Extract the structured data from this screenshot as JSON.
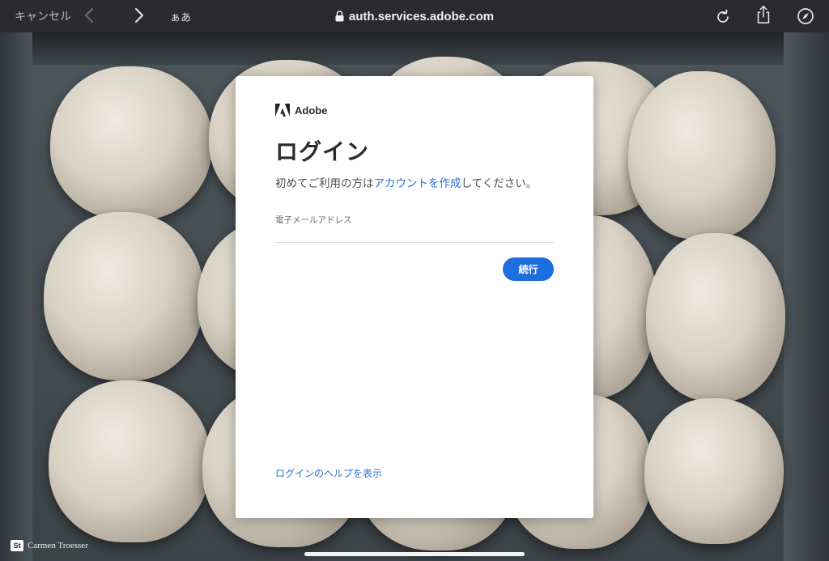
{
  "browser": {
    "cancel_label": "キャンセル",
    "text_size_label": "ぁあ",
    "url": "auth.services.adobe.com",
    "icons": {
      "back": "chevron-left-icon",
      "forward": "chevron-right-icon",
      "lock": "lock-icon",
      "reload": "reload-icon",
      "share": "share-icon",
      "compass": "compass-icon"
    }
  },
  "login": {
    "brand_name": "Adobe",
    "title": "ログイン",
    "subtitle_prefix": "初めてご利用の方は",
    "subtitle_link": "アカウントを作成",
    "subtitle_suffix": "してください。",
    "email_label": "電子メールアドレス",
    "email_value": "",
    "continue_label": "続行",
    "help_link": "ログインのヘルプを表示"
  },
  "credit": {
    "badge": "St",
    "name": "Carmen Troesser"
  },
  "colors": {
    "accent_blue": "#1f6ee0",
    "link_blue": "#2d6fd2",
    "toolbar_bg": "#2b2b2d",
    "card_bg": "#ffffff"
  }
}
